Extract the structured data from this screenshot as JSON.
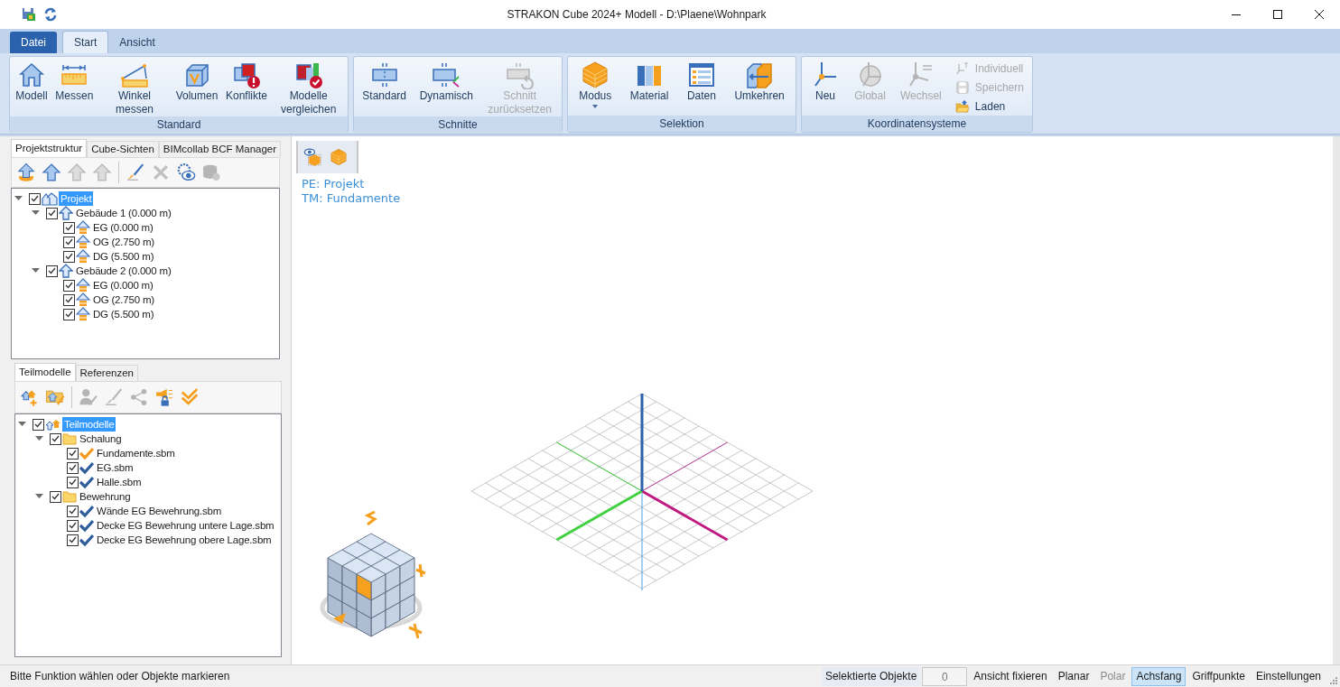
{
  "window": {
    "title": "STRAKON Cube 2024+ Modell - D:\\Plaene\\Wohnpark"
  },
  "ribbon_tabs": [
    {
      "label": "Datei",
      "kind": "file",
      "selected": false
    },
    {
      "label": "Start",
      "kind": "tab",
      "selected": true
    },
    {
      "label": "Ansicht",
      "kind": "tab",
      "selected": false
    }
  ],
  "ribbon_groups": [
    {
      "label": "Standard",
      "buttons": [
        {
          "label": "Modell",
          "kind": "large",
          "disabled": false
        },
        {
          "label": "Messen",
          "kind": "large",
          "disabled": false
        },
        {
          "label": "Winkel messen",
          "kind": "large",
          "disabled": false
        },
        {
          "label": "Volumen",
          "kind": "large",
          "disabled": false
        },
        {
          "label": "Konflikte",
          "kind": "large",
          "disabled": false
        },
        {
          "label": "Modelle vergleichen",
          "kind": "large",
          "disabled": false
        }
      ]
    },
    {
      "label": "Schnitte",
      "buttons": [
        {
          "label": "Standard",
          "kind": "large",
          "disabled": false
        },
        {
          "label": "Dynamisch",
          "kind": "large",
          "disabled": false
        },
        {
          "label": "Schnitt zurücksetzen",
          "kind": "large",
          "disabled": true
        }
      ]
    },
    {
      "label": "Selektion",
      "buttons": [
        {
          "label": "Modus",
          "kind": "dropdown",
          "disabled": false
        },
        {
          "label": "Material",
          "kind": "large",
          "disabled": false
        },
        {
          "label": "Daten",
          "kind": "large",
          "disabled": false
        },
        {
          "label": "Umkehren",
          "kind": "large",
          "disabled": false
        }
      ]
    },
    {
      "label": "Koordinatensysteme",
      "buttons": [
        {
          "label": "Neu",
          "kind": "large",
          "disabled": false
        },
        {
          "label": "Global",
          "kind": "large",
          "disabled": true
        },
        {
          "label": "Wechsel",
          "kind": "large",
          "disabled": true
        },
        {
          "label": "Individuell",
          "kind": "small",
          "disabled": true
        },
        {
          "label": "Speichern",
          "kind": "small",
          "disabled": true
        },
        {
          "label": "Laden",
          "kind": "small",
          "disabled": false
        }
      ]
    }
  ],
  "project_panel": {
    "tabs": [
      {
        "label": "Projektstruktur",
        "selected": true
      },
      {
        "label": "Cube-Sichten",
        "selected": false
      },
      {
        "label": "BIMcollab BCF Manager",
        "selected": false
      }
    ],
    "tools": [
      {
        "disabled": false
      },
      {
        "disabled": false
      },
      {
        "disabled": true
      },
      {
        "disabled": true
      },
      {
        "disabled": false
      },
      {
        "disabled": true
      },
      {
        "disabled": false
      },
      {
        "disabled": true
      }
    ],
    "tree": [
      {
        "label": "Projekt",
        "kind": "project",
        "checked": true,
        "selected": true,
        "expanded": true,
        "children": [
          {
            "label": "Gebäude 1 (0.000 m)",
            "kind": "building",
            "checked": true,
            "selected": false,
            "expanded": true,
            "children": [
              {
                "label": "EG (0.000 m)",
                "kind": "floor",
                "checked": true,
                "selected": false
              },
              {
                "label": "OG (2.750 m)",
                "kind": "floor",
                "checked": true,
                "selected": false
              },
              {
                "label": "DG (5.500 m)",
                "kind": "floor",
                "checked": true,
                "selected": false
              }
            ]
          },
          {
            "label": "Gebäude 2 (0.000 m)",
            "kind": "building",
            "checked": true,
            "selected": false,
            "expanded": true,
            "children": [
              {
                "label": "EG (0.000 m)",
                "kind": "floor",
                "checked": true,
                "selected": false
              },
              {
                "label": "OG (2.750 m)",
                "kind": "floor",
                "checked": true,
                "selected": false
              },
              {
                "label": "DG (5.500 m)",
                "kind": "floor",
                "checked": true,
                "selected": false
              }
            ]
          }
        ]
      }
    ]
  },
  "submodel_panel": {
    "tabs": [
      {
        "label": "Teilmodelle",
        "selected": true
      },
      {
        "label": "Referenzen",
        "selected": false
      }
    ],
    "tools": [
      {
        "disabled": false
      },
      {
        "disabled": false
      },
      {
        "disabled": true
      },
      {
        "disabled": true
      },
      {
        "disabled": true
      },
      {
        "disabled": false
      },
      {
        "disabled": false
      }
    ],
    "tree": [
      {
        "label": "Teilmodelle",
        "kind": "root",
        "checked": true,
        "selected": true,
        "expanded": true,
        "children": [
          {
            "label": "Schalung",
            "kind": "folder",
            "checked": true,
            "selected": false,
            "expanded": true,
            "children": [
              {
                "label": "Fundamente.sbm",
                "kind": "file",
                "checked": true,
                "selected": false,
                "color": "#f39a1e"
              },
              {
                "label": "EG.sbm",
                "kind": "file",
                "checked": true,
                "selected": false,
                "color": "#2f5d9c"
              },
              {
                "label": "Halle.sbm",
                "kind": "file",
                "checked": true,
                "selected": false,
                "color": "#2f5d9c"
              }
            ]
          },
          {
            "label": "Bewehrung",
            "kind": "folder",
            "checked": true,
            "selected": false,
            "expanded": true,
            "children": [
              {
                "label": "Wände EG Bewehrung.sbm",
                "kind": "file",
                "checked": true,
                "selected": false,
                "color": "#2f5d9c"
              },
              {
                "label": "Decke EG Bewehrung untere Lage.sbm",
                "kind": "file",
                "checked": true,
                "selected": false,
                "color": "#2f5d9c"
              },
              {
                "label": "Decke EG Bewehrung obere Lage.sbm",
                "kind": "file",
                "checked": true,
                "selected": false,
                "color": "#2f5d9c"
              }
            ]
          }
        ]
      }
    ]
  },
  "viewport": {
    "info": [
      "PE: Projekt",
      "TM: Fundamente"
    ]
  },
  "status_bar": {
    "message": "Bitte Funktion wählen oder Objekte markieren",
    "items": [
      {
        "kind": "label",
        "label": "Selektierte Objekte"
      },
      {
        "kind": "field",
        "label": "0"
      },
      {
        "kind": "toggle",
        "label": "Ansicht fixieren",
        "selected": false,
        "disabled": false
      },
      {
        "kind": "toggle",
        "label": "Planar",
        "selected": false,
        "disabled": false
      },
      {
        "kind": "toggle",
        "label": "Polar",
        "selected": false,
        "disabled": true
      },
      {
        "kind": "toggle",
        "label": "Achsfang",
        "selected": true,
        "disabled": false
      },
      {
        "kind": "toggle",
        "label": "Griffpunkte",
        "selected": false,
        "disabled": false
      },
      {
        "kind": "toggle",
        "label": "Einstellungen",
        "selected": false,
        "disabled": false
      }
    ]
  }
}
